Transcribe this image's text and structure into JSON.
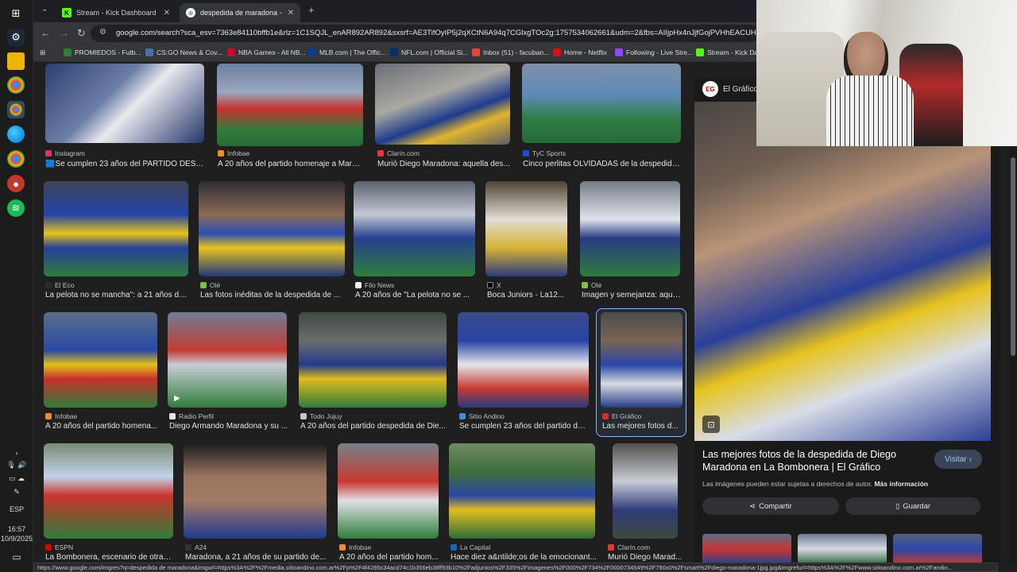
{
  "tabs": [
    {
      "title": "Stream - Kick Dashboard",
      "active": false
    },
    {
      "title": "despedida de maradona - Busc",
      "active": true
    }
  ],
  "address": "google.com/search?sca_esv=7363e84110bffb1e&rlz=1C1SQJL_enAR892AR892&sxsrf=AE3TifOyIP5j2qXCtN6A94q7CGlxgTOc2g:1757534062661&udm=2&fbs=AIIjpHx4nJjfGojPVHhEACUHPiMQht6_",
  "bookmarks": [
    "PROMIEDOS - Futb...",
    "CS:GO News & Cov...",
    "NBA Games - All NB...",
    "MLB.com | The Offic...",
    "NFL.com | Official Si...",
    "Inbox (51) - facuban...",
    "Home - Netflix",
    "Following - Live Stre...",
    "Stream - Kick Das"
  ],
  "system": {
    "lang": "ESP",
    "time": "16:57",
    "date": "10/9/2025"
  },
  "results": {
    "row1": [
      {
        "source": "Instagram",
        "caption": "🟦Se cumplen 23 años del PARTIDO DESP..."
      },
      {
        "source": "Infobae",
        "caption": "A 20 años del partido homenaje a Mara..."
      },
      {
        "source": "Clarín.com",
        "caption": "Murió Diego Maradona: aquella des..."
      },
      {
        "source": "TyC Sports",
        "caption": "Cinco perlitas OLVIDADAS de la despedida ..."
      }
    ],
    "row2": [
      {
        "source": "El Eco",
        "caption": "La pelota no se mancha\": a 21 años de..."
      },
      {
        "source": "Olé",
        "caption": "Las fotos inéditas de la despedida de ..."
      },
      {
        "source": "Filo News",
        "caption": "A 20 años de \"La pelota no se ..."
      },
      {
        "source": "X",
        "caption": "Boca Juniors - La12..."
      },
      {
        "source": "Olé",
        "caption": "Imagen y semejanza: aque..."
      }
    ],
    "row3": [
      {
        "source": "Infobae",
        "caption": "A 20 años del partido homena..."
      },
      {
        "source": "Radio Perfil",
        "caption": "Diego Armando Maradona y su ..."
      },
      {
        "source": "Todo Jujuy",
        "caption": "A 20 años del partido despedida de Die..."
      },
      {
        "source": "Sitio Andino",
        "caption": "Se cumplen 23 años del partido de ..."
      },
      {
        "source": "El Gráfico",
        "caption": "Las mejores fotos d..."
      }
    ],
    "row4": [
      {
        "source": "ESPN",
        "caption": "La Bombonera, escenario de otras..."
      },
      {
        "source": "A24",
        "caption": "Maradona, a 21 años de su partido de..."
      },
      {
        "source": "Infobae",
        "caption": "A 20 años del partido hom..."
      },
      {
        "source": "La Capital",
        "caption": "Hace diez a&ntilde;os de la emocionant..."
      },
      {
        "source": "Clarín.com",
        "caption": "Murió Diego Marad..."
      }
    ]
  },
  "panel": {
    "source": "El Gráfico",
    "logo": "EG",
    "title": "Las mejores fotos de la despedida de Diego Maradona en La Bombonera | El Gráfico",
    "visit": "Visitar",
    "note": "Las imágenes pueden estar sujetas a derechos de autor.",
    "more": "Más información",
    "share": "Compartir",
    "save": "Guardar"
  },
  "status_url": "https://www.google.com/imgres?q=despedida de maradona&imgurl=https%3A%2F%2Fmedia.sitioandino.com.ar%2Fp%2F4f4285c34acd74c1b356eb38ff93b10%2Fadjuntos%2F335%2Fimagenes%2F000%2F734%2F0000734549%2F790x0%2Fsmart%2Fdiego-maradona-1jpg.jpg&imgrefurl=https%3A%2F%2Fwww.sitioandino.com.ar%2Fandin..."
}
